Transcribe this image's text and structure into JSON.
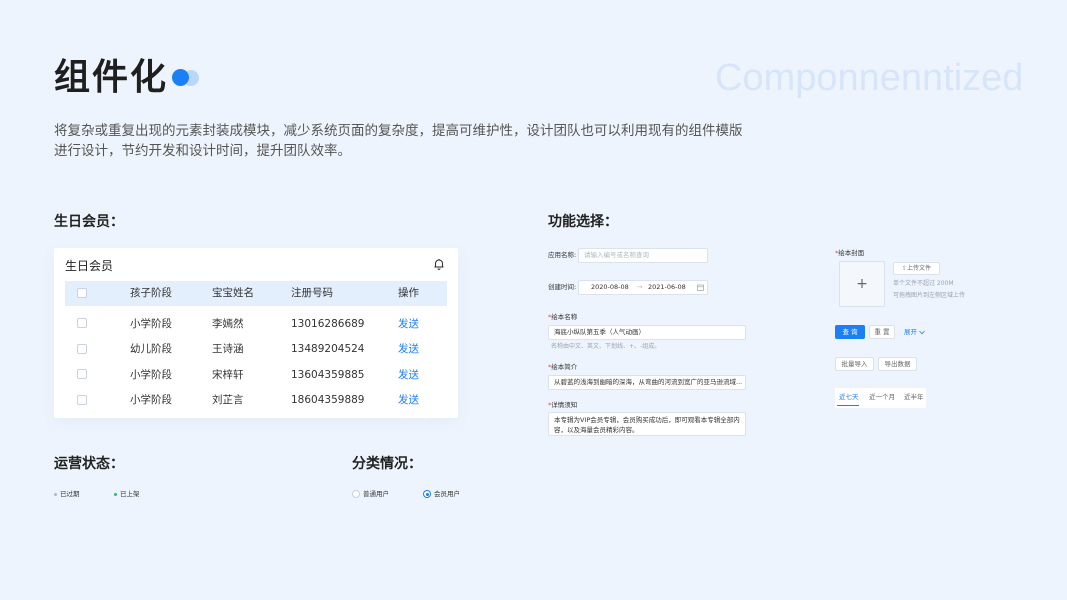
{
  "header": {
    "title": "组件化",
    "watermark": "Componnenntized",
    "description": "将复杂或重复出现的元素封装成模块，减少系统页面的复杂度，提高可维护性，设计团队也可以利用现有的组件模版进行设计，节约开发和设计时间，提升团队效率。"
  },
  "member_section": {
    "heading": "生日会员：",
    "card_title": "生日会员",
    "columns": [
      "孩子阶段",
      "宝宝姓名",
      "注册号码",
      "操作"
    ],
    "rows": [
      {
        "stage": "小学阶段",
        "name": "李嫣然",
        "phone": "13016286689",
        "action": "发送"
      },
      {
        "stage": "幼儿阶段",
        "name": "王诗涵",
        "phone": "13489204524",
        "action": "发送"
      },
      {
        "stage": "小学阶段",
        "name": "宋梓轩",
        "phone": "13604359885",
        "action": "发送"
      },
      {
        "stage": "小学阶段",
        "name": "刘芷言",
        "phone": "18604359889",
        "action": "发送"
      }
    ]
  },
  "status_section": {
    "heading": "运营状态：",
    "items": [
      {
        "label": "已过期",
        "color": "#b0b7c0"
      },
      {
        "label": "已上架",
        "color": "#2bbf6a"
      }
    ]
  },
  "category_section": {
    "heading": "分类情况：",
    "options": [
      {
        "label": "普通用户",
        "selected": false
      },
      {
        "label": "会员用户",
        "selected": true
      }
    ]
  },
  "function_section": {
    "heading": "功能选择：",
    "app_name_label": "应用名称:",
    "app_name_placeholder": "请输入编号或名称查询",
    "created_label": "创建时间:",
    "date_start": "2020-08-08",
    "date_sep": "→",
    "date_end": "2021-06-08",
    "book_name_label": "绘本名称",
    "book_name_value": "海底小纵队第五季（人气动画）",
    "book_name_hint": "名称由中文、英文、下划线、+、-组成。",
    "book_intro_label": "绘本简介",
    "book_intro_value": "从碧蓝的浅海到幽暗的深海，从弯曲的河流到宽广的亚马逊流域...",
    "notice_label": "详情须知",
    "notice_value_1": "本专辑为VIP会员专辑，会员购买成功后，即可观看本专辑全部内",
    "notice_value_2": "容，以及海量会员精彩内容。",
    "cover_label": "绘本封面",
    "upload_plus": "+",
    "upload_button": "上传文件",
    "upload_hint_1": "单个文件不超过 200M",
    "upload_hint_2": "可拖拽图片到左侧区域上传",
    "query_button": "查 询",
    "reset_button": "重 置",
    "expand_label": "展开",
    "batch_import": "批量导入",
    "export_data": "导出数据",
    "time_tabs": [
      "近七天",
      "近一个月",
      "近半年"
    ],
    "active_tab": 0,
    "accent": "#1b7ff5"
  }
}
